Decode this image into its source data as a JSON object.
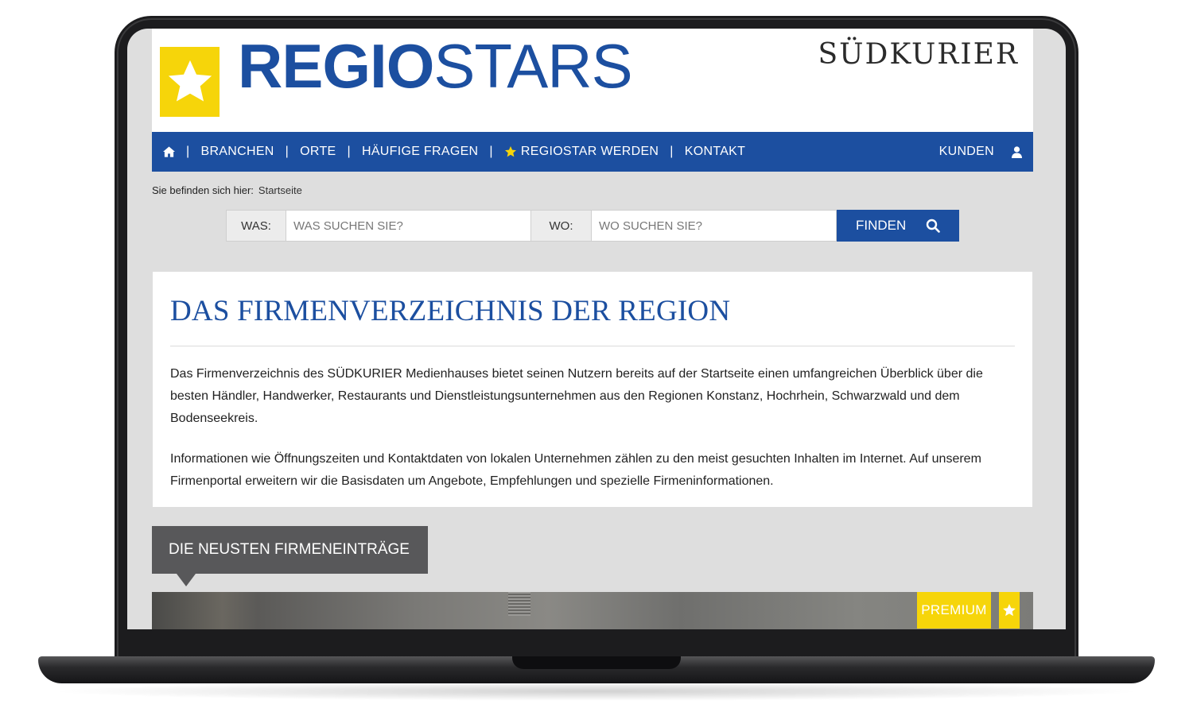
{
  "colors": {
    "brand_blue": "#1c4fa0",
    "brand_yellow": "#f6d50a",
    "tab_gray": "#58585a"
  },
  "header": {
    "logo_part1": "REGIO",
    "logo_part2": "STARS",
    "partner": "SÜDKURIER",
    "logo_icon": "star-icon"
  },
  "nav": {
    "items": [
      "BRANCHEN",
      "ORTE",
      "HÄUFIGE FRAGEN",
      "REGIOSTAR WERDEN",
      "KONTAKT"
    ],
    "separator": "|",
    "right_label": "KUNDEN",
    "icons": {
      "home": "home-icon",
      "star": "star-icon",
      "user": "user-icon"
    }
  },
  "breadcrumb": {
    "prefix": "Sie befinden sich hier:",
    "current": "Startseite"
  },
  "search": {
    "what_label": "WAS:",
    "what_placeholder": "WAS SUCHEN SIE?",
    "where_label": "WO:",
    "where_placeholder": "WO SUCHEN SIE?",
    "button_label": "FINDEN",
    "button_icon": "search-icon"
  },
  "intro": {
    "title": "DAS FIRMENVERZEICHNIS DER REGION",
    "paragraph1": "Das Firmenverzeichnis des SÜDKURIER Medienhauses bietet seinen Nutzern bereits auf der Startseite einen umfangreichen Überblick über die besten Händler, Handwerker, Restaurants und Dienstleistungsunternehmen aus den Regionen Konstanz, Hochrhein, Schwarzwald und dem Bodenseekreis.",
    "paragraph2": "Informationen wie Öffnungszeiten und Kontaktdaten von lokalen Unternehmen zählen zu den meist gesuchten Inhalten im Internet. Auf unserem Firmenportal erweitern wir die Basisdaten um Angebote, Empfehlungen und spezielle Firmeninformationen."
  },
  "latest": {
    "tab_label": "DIE NEUSTEN FIRMENEINTRÄGE",
    "badge": "PREMIUM",
    "badge_icon": "star-icon"
  }
}
